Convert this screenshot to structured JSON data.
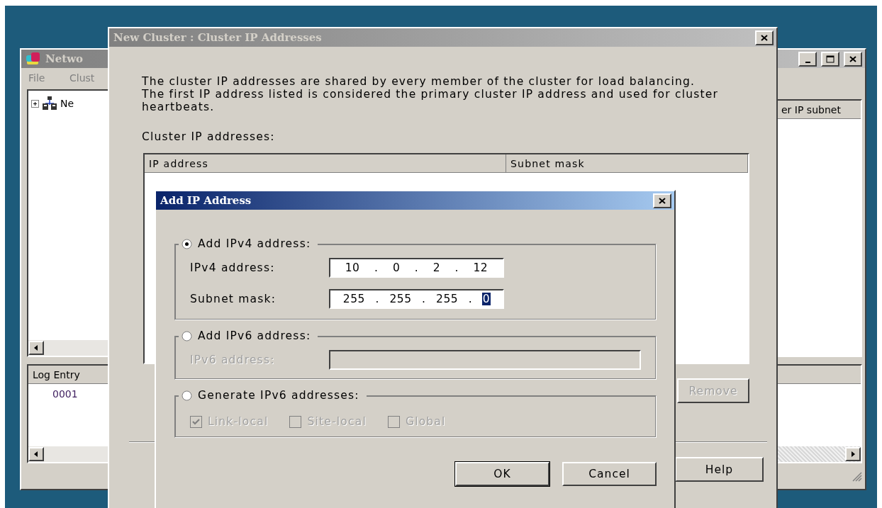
{
  "main_window": {
    "title": "Netwo",
    "menu": [
      "File",
      "Clust"
    ],
    "tree": [
      {
        "label": "Ne",
        "expanded": false
      }
    ],
    "right_pane_header": "er IP subnet",
    "log": {
      "column": "Log Entry",
      "rows": [
        "0001"
      ]
    }
  },
  "wizard": {
    "title": "New Cluster : Cluster IP Addresses",
    "description": [
      "The cluster IP addresses are shared by every member of the cluster for load balancing.",
      "The first IP address listed is considered the primary cluster IP address and used for cluster heartbeats."
    ],
    "list_label": "Cluster IP addresses:",
    "list_columns": [
      "IP address",
      "Subnet mask"
    ],
    "buttons": [
      {
        "label": "Remove",
        "disabled": true
      },
      {
        "label": "Help",
        "disabled": false
      }
    ]
  },
  "dialog": {
    "title": "Add IP Address",
    "groups": [
      {
        "kind": "ipv4",
        "label": "Add IPv4 address:",
        "selected": true,
        "disabled": false,
        "fields": [
          {
            "label": "IPv4 address:",
            "separator": ".",
            "octets": [
              {
                "value": "10",
                "selected": false
              },
              {
                "value": "0",
                "selected": false
              },
              {
                "value": "2",
                "selected": false
              },
              {
                "value": "12",
                "selected": false
              }
            ]
          },
          {
            "label": "Subnet mask:",
            "separator": ".",
            "octets": [
              {
                "value": "255",
                "selected": false
              },
              {
                "value": "255",
                "selected": false
              },
              {
                "value": "255",
                "selected": false
              },
              {
                "value": "0",
                "selected": true
              }
            ]
          }
        ]
      },
      {
        "kind": "ipv6",
        "label": "Add IPv6 address:",
        "selected": false,
        "disabled": true,
        "field_label": "IPv6 address:"
      },
      {
        "kind": "generate",
        "label": "Generate IPv6 addresses:",
        "selected": false,
        "disabled": true,
        "options": [
          {
            "label": "Link-local",
            "checked": true
          },
          {
            "label": "Site-local",
            "checked": false
          },
          {
            "label": "Global",
            "checked": false
          }
        ]
      }
    ],
    "buttons": [
      {
        "label": "OK",
        "default": true
      },
      {
        "label": "Cancel",
        "default": false
      }
    ]
  }
}
